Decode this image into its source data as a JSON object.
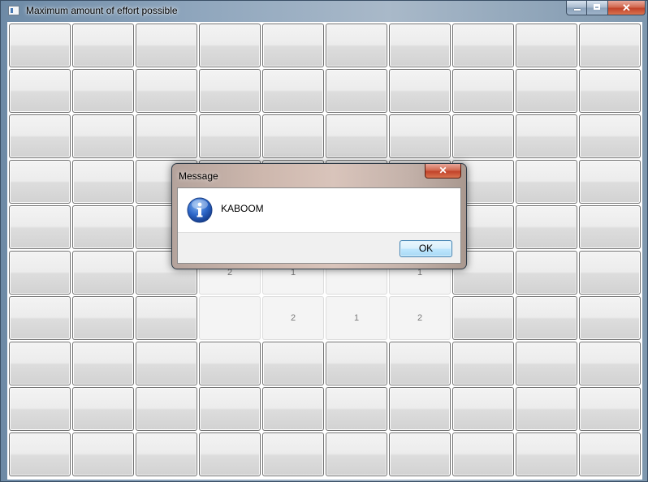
{
  "window": {
    "title": "Maximum amount of effort possible",
    "icon": "app-window-icon"
  },
  "board": {
    "rows": 10,
    "cols": 10,
    "revealed": [
      {
        "row": 5,
        "col": 3,
        "label": "2"
      },
      {
        "row": 5,
        "col": 4,
        "label": "1"
      },
      {
        "row": 5,
        "col": 5,
        "label": ""
      },
      {
        "row": 5,
        "col": 6,
        "label": "1"
      },
      {
        "row": 6,
        "col": 3,
        "label": ""
      },
      {
        "row": 6,
        "col": 4,
        "label": "2"
      },
      {
        "row": 6,
        "col": 5,
        "label": "1"
      },
      {
        "row": 6,
        "col": 6,
        "label": "2"
      }
    ]
  },
  "dialog": {
    "title": "Message",
    "message": "KABOOM",
    "icon": "info-icon",
    "ok_label": "OK",
    "close_label": "x"
  }
}
